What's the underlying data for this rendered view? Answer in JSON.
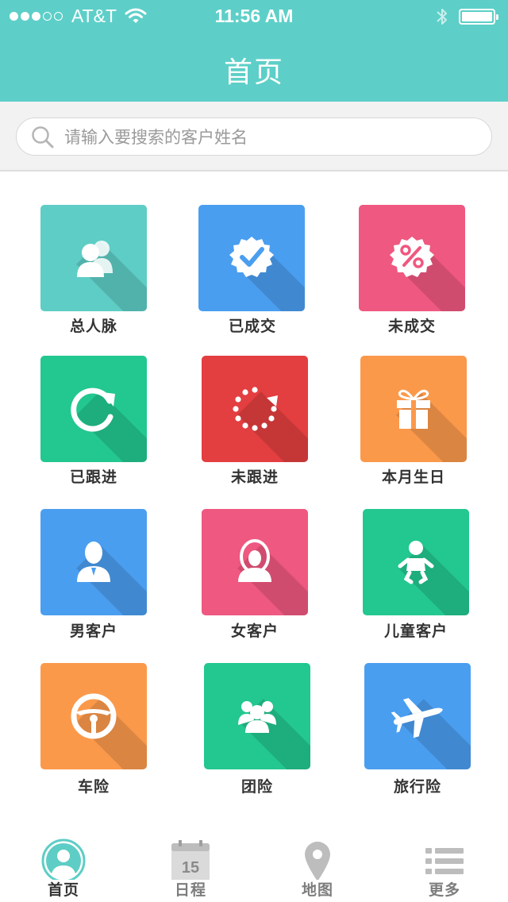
{
  "status_bar": {
    "carrier": "AT&T",
    "time": "11:56 AM",
    "signal_bars": 3,
    "signal_max": 5,
    "battery_level": 1.0
  },
  "header": {
    "title": "首页"
  },
  "search": {
    "placeholder": "请输入要搜索的客户姓名",
    "value": ""
  },
  "grid": {
    "items": [
      {
        "label": "总人脉",
        "icon": "people-icon",
        "color": "#5ecdc5"
      },
      {
        "label": "已成交",
        "icon": "verified-badge-icon",
        "color": "#4a9ef0"
      },
      {
        "label": "未成交",
        "icon": "percent-badge-icon",
        "color": "#ef5880"
      },
      {
        "label": "已跟进",
        "icon": "refresh-icon",
        "color": "#23c790"
      },
      {
        "label": "未跟进",
        "icon": "loading-dots-icon",
        "color": "#e33e40"
      },
      {
        "label": "本月生日",
        "icon": "gift-icon",
        "color": "#fb994b"
      },
      {
        "label": "男客户",
        "icon": "male-user-icon",
        "color": "#4a9ef0"
      },
      {
        "label": "女客户",
        "icon": "female-user-icon",
        "color": "#ef5880"
      },
      {
        "label": "儿童客户",
        "icon": "baby-icon",
        "color": "#23c790"
      },
      {
        "label": "车险",
        "icon": "steering-wheel-icon",
        "color": "#fb994b"
      },
      {
        "label": "团险",
        "icon": "group-icon",
        "color": "#23c790"
      },
      {
        "label": "旅行险",
        "icon": "airplane-icon",
        "color": "#4a9ef0"
      }
    ]
  },
  "tabbar": {
    "active_color": "#5ecdc5",
    "items": [
      {
        "label": "首页",
        "icon": "home-avatar-icon",
        "active": true
      },
      {
        "label": "日程",
        "icon": "calendar-icon",
        "calendar_day": "15",
        "active": false
      },
      {
        "label": "地图",
        "icon": "map-pin-icon",
        "active": false
      },
      {
        "label": "更多",
        "icon": "list-icon",
        "active": false
      }
    ]
  }
}
